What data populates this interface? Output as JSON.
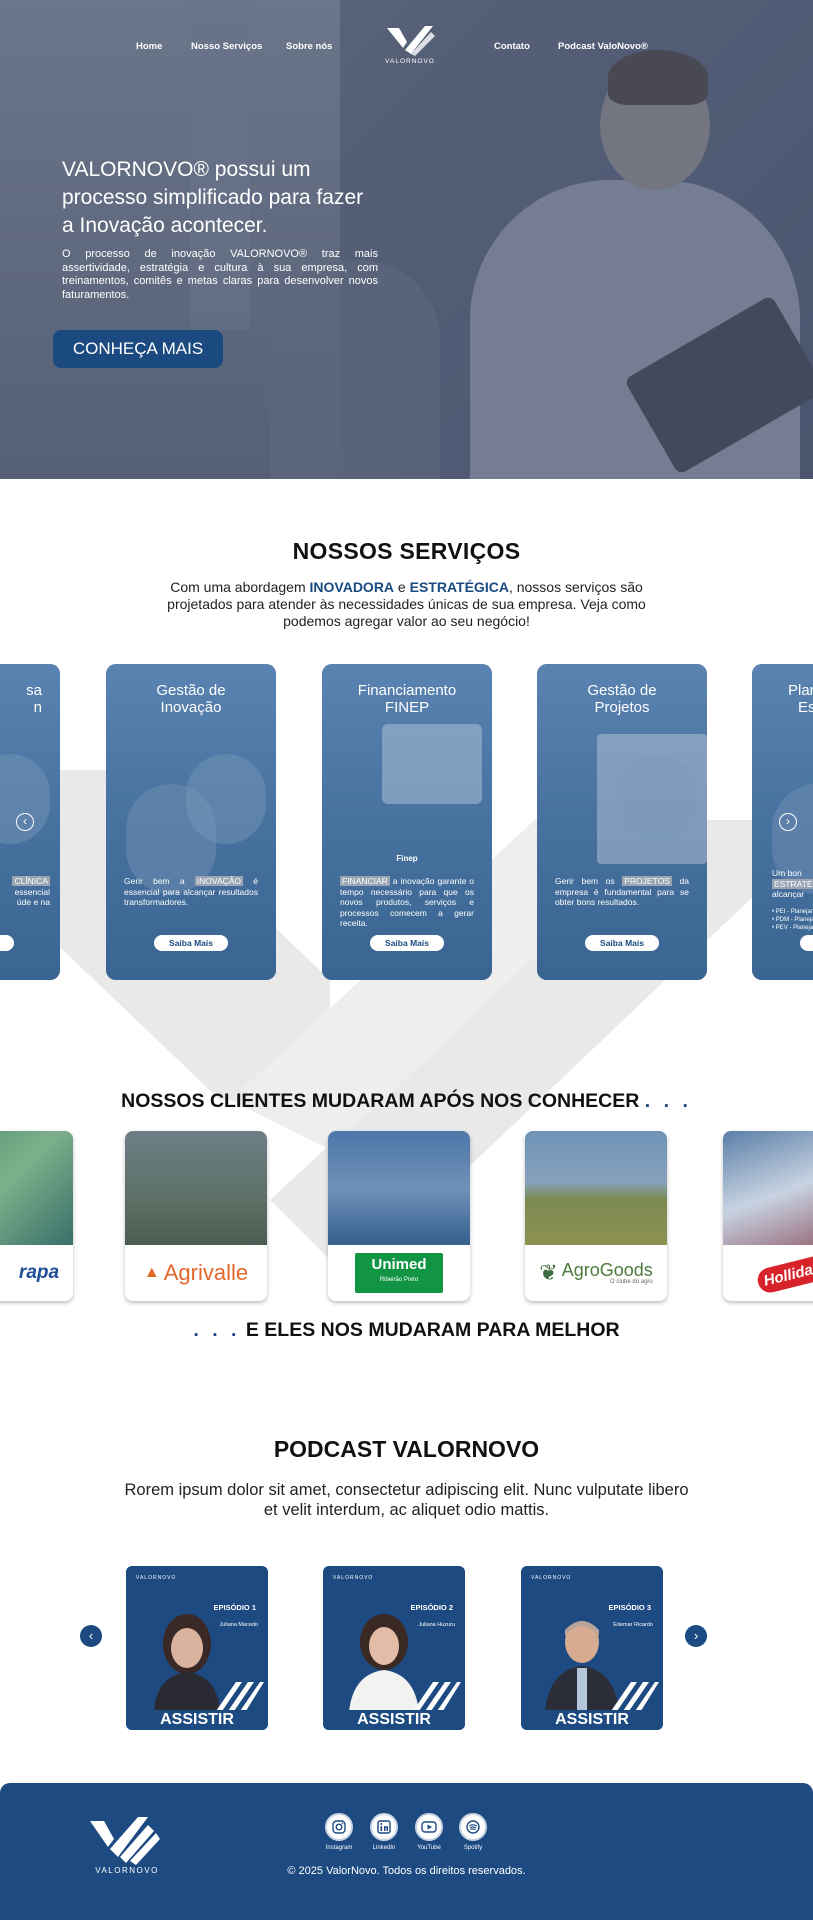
{
  "nav": {
    "home": "Home",
    "services": "Nosso Serviços",
    "about": "Sobre nós",
    "logo_text": "VALORNOVO",
    "contact": "Contato",
    "podcast": "Podcast ValoNovo®"
  },
  "hero": {
    "title": "VALORNOVO® possui   um processo simplificado para fazer a Inovação acontecer.",
    "text": "O processo de inovação VALORNOVO® traz mais assertividade, estratégia e cultura à sua empresa, com treinamentos, comitês e metas claras para desenvolver novos faturamentos.",
    "button": "CONHEÇA MAIS"
  },
  "services": {
    "title": "NOSSOS SERVIÇOS",
    "subtitle_pre": "Com uma abordagem ",
    "subtitle_b1": "INOVADORA",
    "subtitle_mid": " e ",
    "subtitle_b2": "ESTRATÉGICA",
    "subtitle_post": ", nossos serviços são projetados para atender às necessidades únicas de sua empresa. Veja como podemos agregar valor ao seu negócio!",
    "cards": [
      {
        "title_1": "sa",
        "title_2": "n",
        "hl": "CLÍNICA",
        "desc": "essencial",
        "desc2": "úde e na"
      },
      {
        "title_1": "Gestão de",
        "title_2": "Inovação",
        "pre": "Gerir bem a ",
        "hl": "INOVAÇÃO",
        "desc": " é essencial para alcançar resultados transformadores.",
        "btn": "Saiba Mais"
      },
      {
        "title_1": "Financiamento",
        "title_2": "FINEP",
        "pre": "",
        "hl": "FINANCIAR",
        "desc": " a inovação garante o tempo necessário para que os novos produtos, serviços e processos comecem a gerar receita.",
        "btn": "Saiba Mais",
        "brand": "Finep"
      },
      {
        "title_1": "Gestão de",
        "title_2": "Projetos",
        "pre": "Gerir bem os ",
        "hl": "PROJETOS",
        "desc": " da empresa é fundamental para se obter bons resultados.",
        "btn": "Saiba Mais"
      },
      {
        "title_1": "Plan",
        "title_2": "Es",
        "pre": "Um bon",
        "hl": "ESTRATÉ",
        "desc": "alcançar",
        "list": [
          "• PEI - Planejam",
          "• PDM - Planeja",
          "• PEV - Planejam"
        ]
      }
    ],
    "arrow_left": "‹",
    "arrow_right": "›"
  },
  "clients": {
    "title": "NOSSOS CLIENTES MUDARAM APÓS NOS CONHECER",
    "dots": ". . .",
    "logos": [
      "rapa",
      "Agrivalle",
      "Unimed",
      "AgroGoods",
      "Hollidays"
    ],
    "unimed_sub": "Ribeirão Preto",
    "agrogoods_sub": "O clube do agro",
    "subtitle": "E ELES NOS MUDARAM PARA MELHOR"
  },
  "podcast": {
    "title": "PODCAST VALORNOVO",
    "subtitle": "Rorem ipsum dolor sit amet, consectetur adipiscing elit. Nunc vulputate libero et velit interdum, ac aliquet odio mattis.",
    "logo_text": "VALORNOVO",
    "episodes": [
      {
        "num": "EPISÓDIO 1",
        "guest": "Juliana Macedo",
        "btn": "ASSISTIR"
      },
      {
        "num": "EPISÓDIO 2",
        "guest": "Juliana Huzuru",
        "btn": "ASSISTIR"
      },
      {
        "num": "EPISÓDIO 3",
        "guest": "Edemar Ricardo",
        "btn": "ASSISTIR"
      }
    ]
  },
  "footer": {
    "logo_text": "VALORNOVO",
    "social": [
      "Instagram",
      "LinkedIn",
      "YouTube",
      "Spotify"
    ],
    "copyright": "© 2025 ValorNovo. Todos os direitos reservados."
  },
  "colors": {
    "brand": "#1c4a81",
    "hero_overlay": "#5d677d"
  }
}
